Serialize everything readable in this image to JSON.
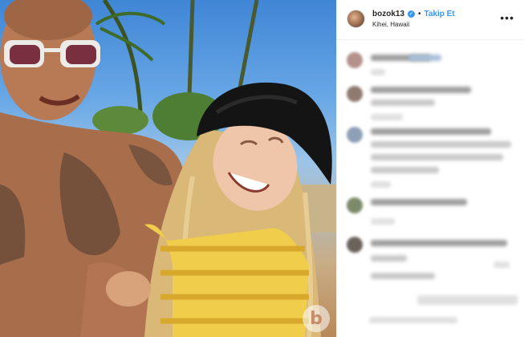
{
  "post": {
    "username": "bozok13",
    "follow_label": "Takip Et",
    "separator": "•",
    "location": "Kihei, Hawaii"
  },
  "photo": {
    "watermark": "b"
  },
  "icons": {
    "verified": "verified-badge-icon",
    "more": "more-options-icon"
  },
  "colors": {
    "accent": "#3897f0",
    "text": "#262626"
  }
}
